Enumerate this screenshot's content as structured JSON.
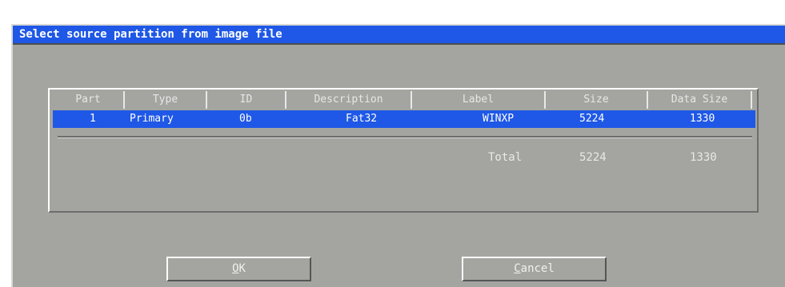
{
  "dialog": {
    "title": "Select source partition from image file"
  },
  "table": {
    "columns": [
      "Part",
      "Type",
      "ID",
      "Description",
      "Label",
      "Size",
      "Data Size"
    ],
    "rows": [
      {
        "part": "1",
        "type": "Primary",
        "id": "0b",
        "description": "Fat32",
        "label": "WINXP",
        "size": "5224",
        "data_size": "1330"
      }
    ],
    "total": {
      "label": "Total",
      "size": "5224",
      "data_size": "1330"
    }
  },
  "buttons": {
    "ok": {
      "mnemonic": "O",
      "rest": "K"
    },
    "cancel": {
      "mnemonic": "C",
      "rest": "ancel"
    }
  },
  "colors": {
    "titlebar": "#1f58e6",
    "selection": "#1f58e6",
    "dialog_bg": "#a4a5a0"
  }
}
